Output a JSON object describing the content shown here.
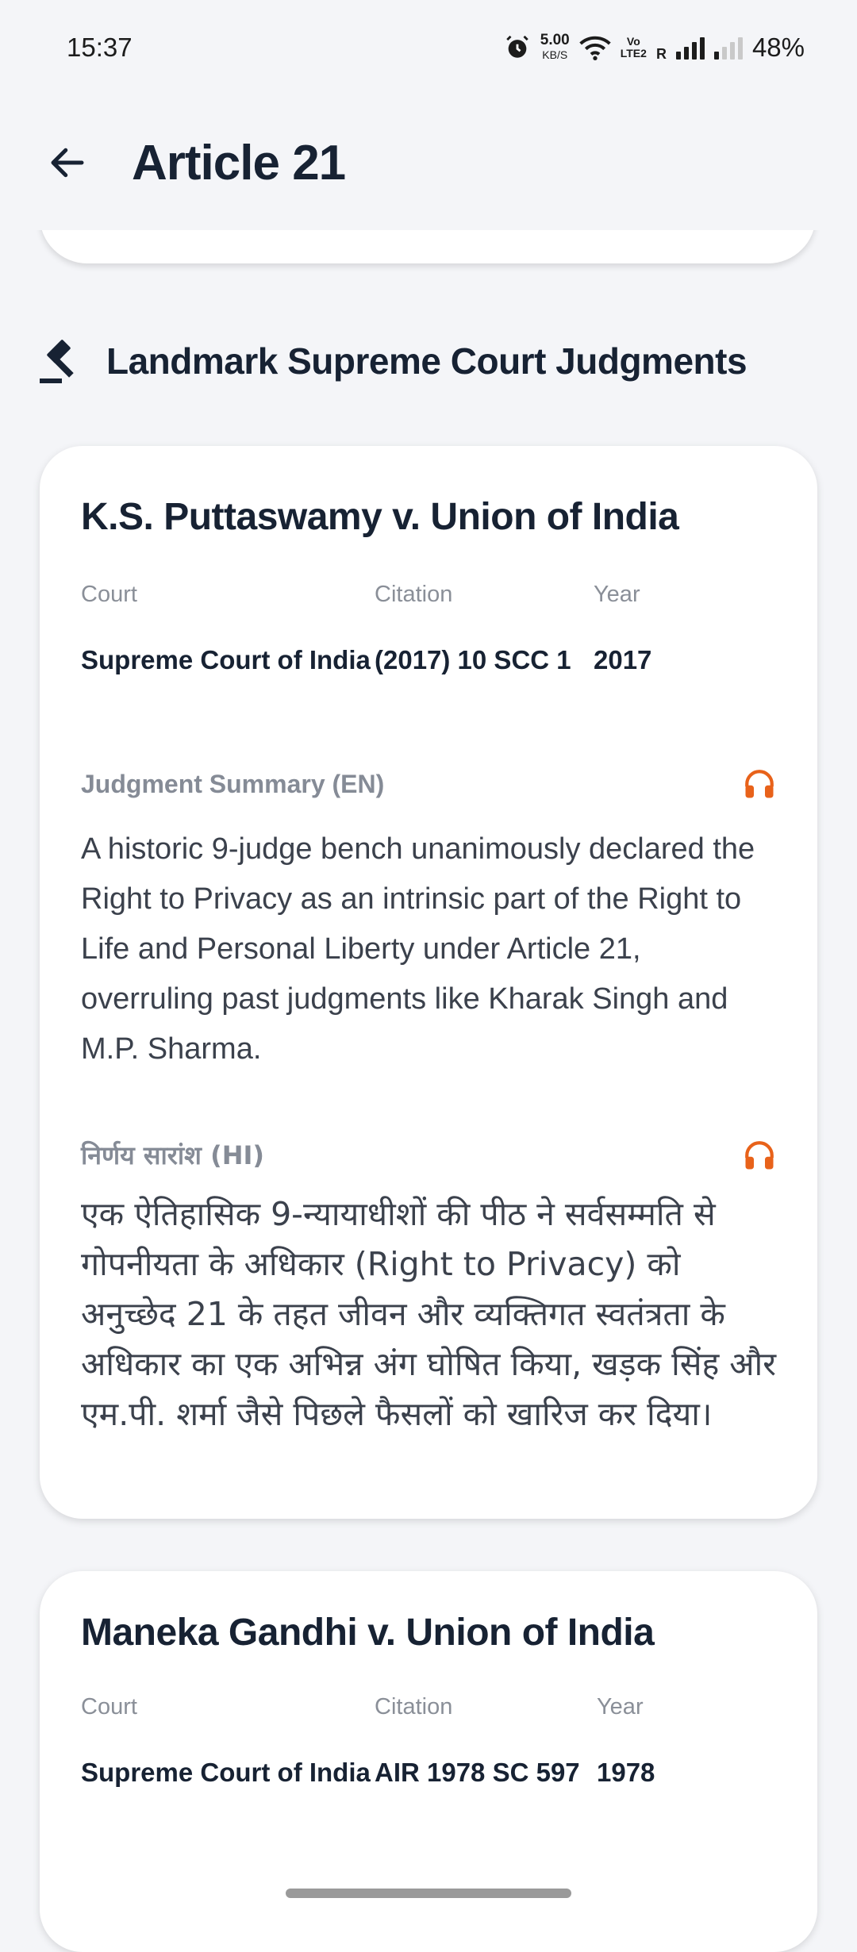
{
  "status_bar": {
    "time": "15:37",
    "net_speed": "5.00",
    "net_unit": "KB/S",
    "volte": "Vo\nLTE2",
    "roaming": "R",
    "battery": "48%"
  },
  "app_bar": {
    "title": "Article 21"
  },
  "section": {
    "title": "Landmark Supreme Court Judgments",
    "icon": "gavel-icon"
  },
  "labels": {
    "court": "Court",
    "citation": "Citation",
    "year": "Year",
    "summary_en": "Judgment Summary (EN)",
    "summary_hi": "निर्णय सारांश (HI)"
  },
  "judgments": [
    {
      "title": "K.S. Puttaswamy v. Union of India",
      "court": "Supreme Court of India",
      "citation": "(2017) 10 SCC 1",
      "year": "2017",
      "summary_en": "A historic 9-judge bench unanimously declared the Right to Privacy as an intrinsic part of the Right to Life and Personal Liberty under Article 21, overruling past judgments like Kharak Singh and M.P. Sharma.",
      "summary_hi": "एक ऐतिहासिक 9-न्यायाधीशों की पीठ ने सर्वसम्मति से गोपनीयता के अधिकार (Right to Privacy) को अनुच्छेद 21 के तहत जीवन और व्यक्तिगत स्वतंत्रता के अधिकार का एक अभिन्न अंग घोषित किया, खड़क सिंह और एम.पी. शर्मा जैसे पिछले फैसलों को खारिज कर दिया।"
    },
    {
      "title": "Maneka Gandhi v. Union of India",
      "court": "Supreme Court of India",
      "citation": "AIR 1978 SC 597",
      "year": "1978"
    }
  ],
  "colors": {
    "accent": "#e8621a",
    "title": "#172233",
    "label": "#8a8f98",
    "background": "#f4f5f8"
  }
}
